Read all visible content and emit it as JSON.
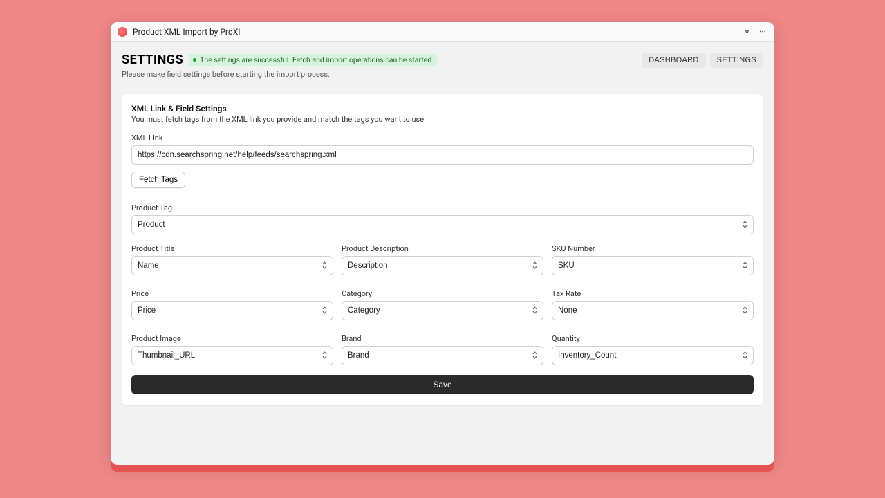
{
  "titlebar": {
    "title": "Product XML Import by ProXI"
  },
  "header": {
    "title": "SETTINGS",
    "status_text": "The settings are successful. Fetch and import operations can be started",
    "subtitle": "Please make field settings before starting the import process.",
    "tabs": {
      "dashboard": "DASHBOARD",
      "settings": "SETTINGS"
    }
  },
  "card": {
    "title": "XML Link & Field Settings",
    "subtitle": "You must fetch tags from the XML link you provide and match the tags you want to use.",
    "xml_link_label": "XML Link",
    "xml_link_value": "https://cdn.searchspring.net/help/feeds/searchspring.xml",
    "fetch_label": "Fetch Tags",
    "product_tag_label": "Product Tag",
    "product_tag_value": "Product",
    "fields": [
      {
        "label": "Product Title",
        "value": "Name"
      },
      {
        "label": "Product Description",
        "value": "Description"
      },
      {
        "label": "SKU Number",
        "value": "SKU"
      },
      {
        "label": "Price",
        "value": "Price"
      },
      {
        "label": "Category",
        "value": "Category"
      },
      {
        "label": "Tax Rate",
        "value": "None"
      },
      {
        "label": "Product Image",
        "value": "Thumbnail_URL"
      },
      {
        "label": "Brand",
        "value": "Brand"
      },
      {
        "label": "Quantity",
        "value": "Inventory_Count"
      }
    ],
    "save_label": "Save"
  }
}
